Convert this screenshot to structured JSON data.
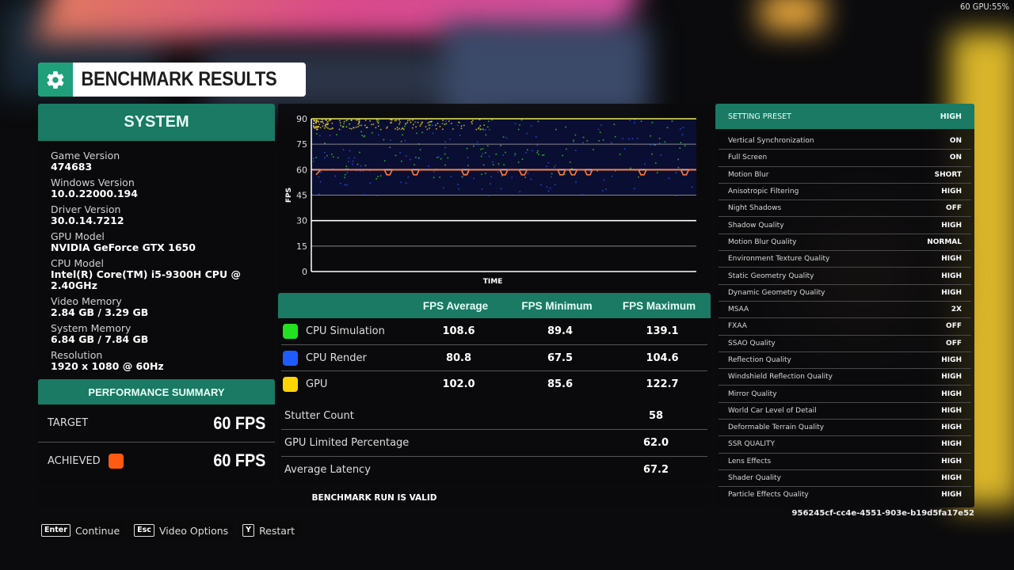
{
  "hud": {
    "fps_overlay": "60 GPU:55%"
  },
  "title": {
    "text": "BENCHMARK RESULTS",
    "icon": "gear-icon"
  },
  "system": {
    "header": "SYSTEM",
    "items": [
      {
        "label": "Game Version",
        "value": "474683"
      },
      {
        "label": "Windows Version",
        "value": "10.0.22000.194"
      },
      {
        "label": "Driver Version",
        "value": "30.0.14.7212"
      },
      {
        "label": "GPU Model",
        "value": "NVIDIA GeForce GTX 1650"
      },
      {
        "label": "CPU Model",
        "value": "Intel(R) Core(TM) i5-9300H CPU @ 2.40GHz"
      },
      {
        "label": "Video Memory",
        "value": "2.84 GB / 3.29 GB"
      },
      {
        "label": "System Memory",
        "value": "6.84 GB / 7.84 GB"
      },
      {
        "label": "Resolution",
        "value": "1920 x 1080 @ 60Hz"
      }
    ]
  },
  "performance_summary": {
    "header": "PERFORMANCE SUMMARY",
    "target_label": "TARGET",
    "target_value": "60 FPS",
    "achieved_label": "ACHIEVED",
    "achieved_value": "60 FPS",
    "achieved_color": "#ff5a14"
  },
  "chart_data": {
    "type": "scatter",
    "title": "",
    "xlabel": "TIME",
    "ylabel": "FPS",
    "ylim": [
      0,
      90
    ],
    "yticks": [
      "90",
      "75",
      "60",
      "45",
      "30",
      "15",
      "0"
    ],
    "grid": true,
    "reference_lines": [
      {
        "name": "cap",
        "value": 90,
        "color": "#e8e85a"
      },
      {
        "name": "target",
        "value": 60,
        "color": "#f0a080"
      },
      {
        "name": "30fps",
        "value": 30,
        "color": "#ffffff"
      }
    ],
    "series": [
      {
        "name": "CPU Simulation",
        "color": "#2ee82e",
        "range": [
          55,
          90
        ]
      },
      {
        "name": "CPU Render",
        "color": "#2a5cff",
        "range": [
          45,
          90
        ]
      },
      {
        "name": "GPU",
        "color": "#ffe020",
        "range": [
          84,
          90
        ]
      },
      {
        "name": "Achieved FPS",
        "color": "#ff7a3c",
        "typical": 60,
        "dips_to": 57
      }
    ]
  },
  "fps_table": {
    "columns": [
      "FPS Average",
      "FPS Minimum",
      "FPS Maximum"
    ],
    "rows": [
      {
        "name": "CPU Simulation",
        "color": "#22e022",
        "avg": "108.6",
        "min": "89.4",
        "max": "139.1"
      },
      {
        "name": "CPU Render",
        "color": "#1e5cff",
        "avg": "80.8",
        "min": "67.5",
        "max": "104.6"
      },
      {
        "name": "GPU",
        "color": "#ffd400",
        "avg": "102.0",
        "min": "85.6",
        "max": "122.7"
      }
    ]
  },
  "stats": [
    {
      "label": "Stutter Count",
      "value": "58"
    },
    {
      "label": "GPU Limited Percentage",
      "value": "62.0"
    },
    {
      "label": "Average Latency",
      "value": "67.2"
    }
  ],
  "validity": "BENCHMARK RUN IS VALID",
  "settings": {
    "preset_label": "SETTING PRESET",
    "preset_value": "HIGH",
    "items": [
      {
        "label": "Vertical Synchronization",
        "value": "ON"
      },
      {
        "label": "Full Screen",
        "value": "ON"
      },
      {
        "label": "Motion Blur",
        "value": "SHORT"
      },
      {
        "label": "Anisotropic Filtering",
        "value": "HIGH"
      },
      {
        "label": "Night Shadows",
        "value": "OFF"
      },
      {
        "label": "Shadow Quality",
        "value": "HIGH"
      },
      {
        "label": "Motion Blur Quality",
        "value": "NORMAL"
      },
      {
        "label": "Environment Texture Quality",
        "value": "HIGH"
      },
      {
        "label": "Static Geometry Quality",
        "value": "HIGH"
      },
      {
        "label": "Dynamic Geometry Quality",
        "value": "HIGH"
      },
      {
        "label": "MSAA",
        "value": "2X"
      },
      {
        "label": "FXAA",
        "value": "OFF"
      },
      {
        "label": "SSAO Quality",
        "value": "OFF"
      },
      {
        "label": "Reflection Quality",
        "value": "HIGH"
      },
      {
        "label": "Windshield Reflection Quality",
        "value": "HIGH"
      },
      {
        "label": "Mirror Quality",
        "value": "HIGH"
      },
      {
        "label": "World Car Level of Detail",
        "value": "HIGH"
      },
      {
        "label": "Deformable Terrain Quality",
        "value": "HIGH"
      },
      {
        "label": "SSR QUALITY",
        "value": "HIGH"
      },
      {
        "label": "Lens Effects",
        "value": "HIGH"
      },
      {
        "label": "Shader Quality",
        "value": "HIGH"
      },
      {
        "label": "Particle Effects Quality",
        "value": "HIGH"
      }
    ]
  },
  "run_id": "956245cf-cc4e-4551-903e-b19d5fa17e52",
  "footer": [
    {
      "key": "Enter",
      "label": "Continue"
    },
    {
      "key": "Esc",
      "label": "Video Options"
    },
    {
      "key": "Y",
      "label": "Restart"
    }
  ]
}
